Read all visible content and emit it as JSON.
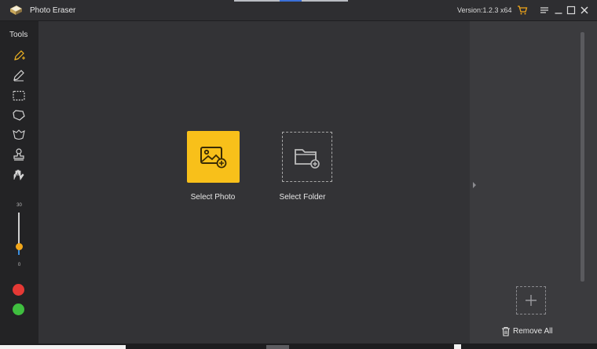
{
  "window": {
    "app_title": "Photo Eraser",
    "version": "Version:1.2.3 x64",
    "logo_icon": "photo-eraser-logo",
    "controls": [
      "cart-icon",
      "menu-icon",
      "minimize-icon",
      "maximize-icon",
      "close-icon"
    ],
    "accent_color": "#f8c01a"
  },
  "toolbar": {
    "title": "Tools",
    "tools": [
      {
        "icon": "smart-brush-icon",
        "active": true
      },
      {
        "icon": "brush-icon"
      },
      {
        "icon": "rectangle-select-icon"
      },
      {
        "icon": "lasso-icon"
      },
      {
        "icon": "magic-select-icon"
      },
      {
        "icon": "clone-stamp-icon"
      },
      {
        "icon": "eraser-hand-icon"
      }
    ],
    "brush_size": {
      "max_label": "30",
      "min_label": "0",
      "value": 6,
      "max": 30
    },
    "colors": [
      "#e53935",
      "#3fbe3f"
    ]
  },
  "main": {
    "select_photo_label": "Select Photo",
    "select_folder_label": "Select Folder"
  },
  "sidebar": {
    "remove_all_label": "Remove All"
  }
}
